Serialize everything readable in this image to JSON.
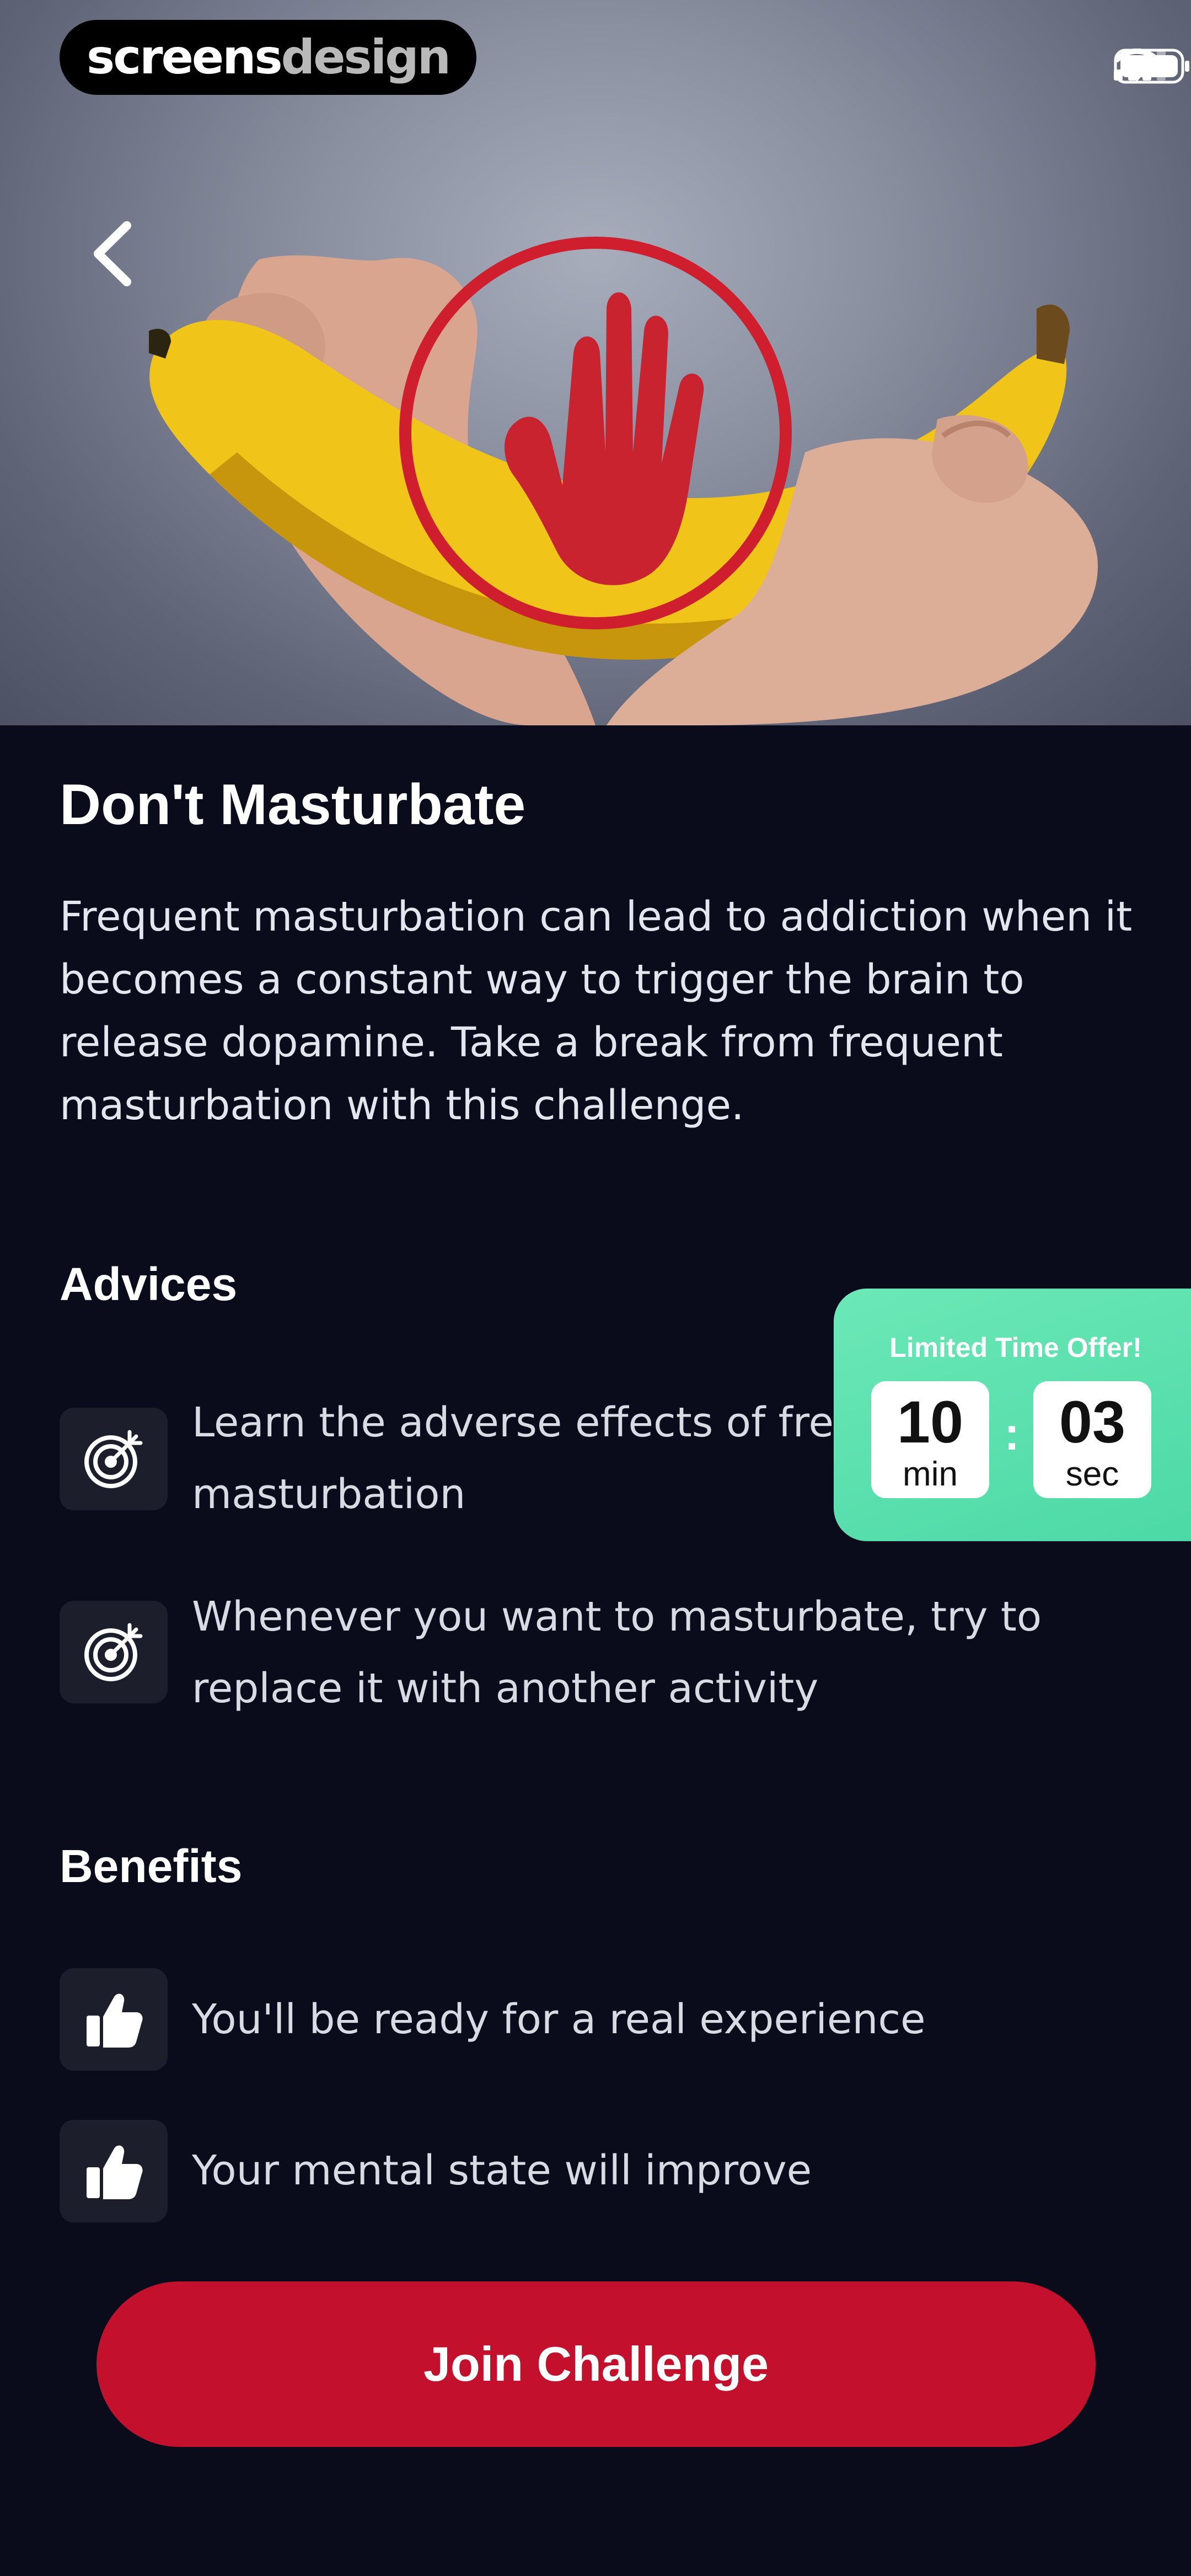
{
  "brand": {
    "part1": "screens",
    "part2": "design"
  },
  "hero": {
    "image_description": "Hands holding a banana with a red stop-hand sign",
    "back_icon": "chevron-left-icon"
  },
  "challenge": {
    "title": "Don't Masturbate",
    "description": "Frequent masturbation can lead to addiction when it becomes a constant way to trigger the brain to release dopamine. Take a break from frequent masturbation with this challenge."
  },
  "advices": {
    "title": "Advices",
    "items": [
      {
        "icon": "target-icon",
        "text": "Learn the adverse effects of frequent masturbation"
      },
      {
        "icon": "target-icon",
        "text": "Whenever you want to masturbate, try to replace it with another activity"
      }
    ]
  },
  "benefits": {
    "title": "Benefits",
    "items": [
      {
        "icon": "thumbs-up-icon",
        "text": "You'll be ready for a real experience"
      },
      {
        "icon": "thumbs-up-icon",
        "text": "Your mental state will improve"
      }
    ]
  },
  "offer": {
    "title": "Limited Time Offer!",
    "minutes": "10",
    "minutes_label": "min",
    "seconds": "03",
    "seconds_label": "sec",
    "separator": ":"
  },
  "cta": {
    "label": "Join Challenge"
  },
  "colors": {
    "background": "#0a0c1c",
    "accent": "#c3112d",
    "offer": "#5ce0ae"
  }
}
